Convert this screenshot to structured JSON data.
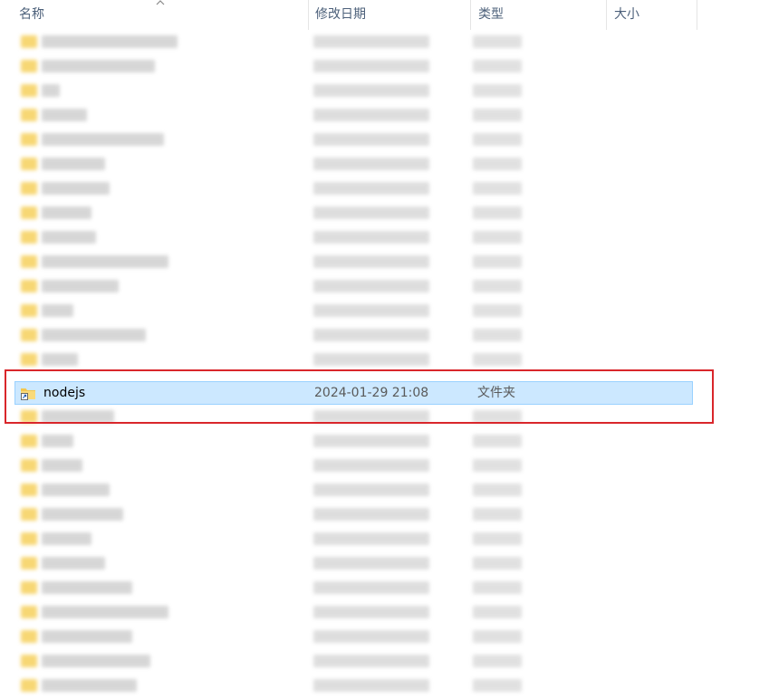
{
  "columns": {
    "name": "名称",
    "date_modified": "修改日期",
    "type": "类型",
    "size": "大小"
  },
  "selected_item": {
    "name": "nodejs",
    "date_modified": "2024-01-29 21:08",
    "type": "文件夹",
    "icon": "folder-shortcut-icon"
  },
  "colors": {
    "selection_background": "#cce8ff",
    "selection_border": "#99d1ff",
    "highlight_box": "#d9262b",
    "folder": "#f7d774",
    "header_text": "#4c607a"
  }
}
